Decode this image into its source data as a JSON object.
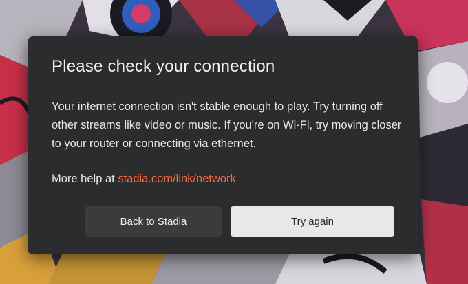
{
  "dialog": {
    "title": "Please check your connection",
    "body": "Your internet connection isn't stable enough to play. Try turning off other streams like video or music. If you're on Wi-Fi, try moving closer to your router or connecting via ethernet.",
    "help_prefix": "More help at ",
    "help_link": "stadia.com/link/network",
    "back_label": "Back to Stadia",
    "retry_label": "Try again"
  },
  "colors": {
    "dialog_bg": "#2b2c2e",
    "link": "#ff6b3d",
    "primary_button": "#e8e8ea",
    "secondary_button": "#3a3b3d"
  }
}
